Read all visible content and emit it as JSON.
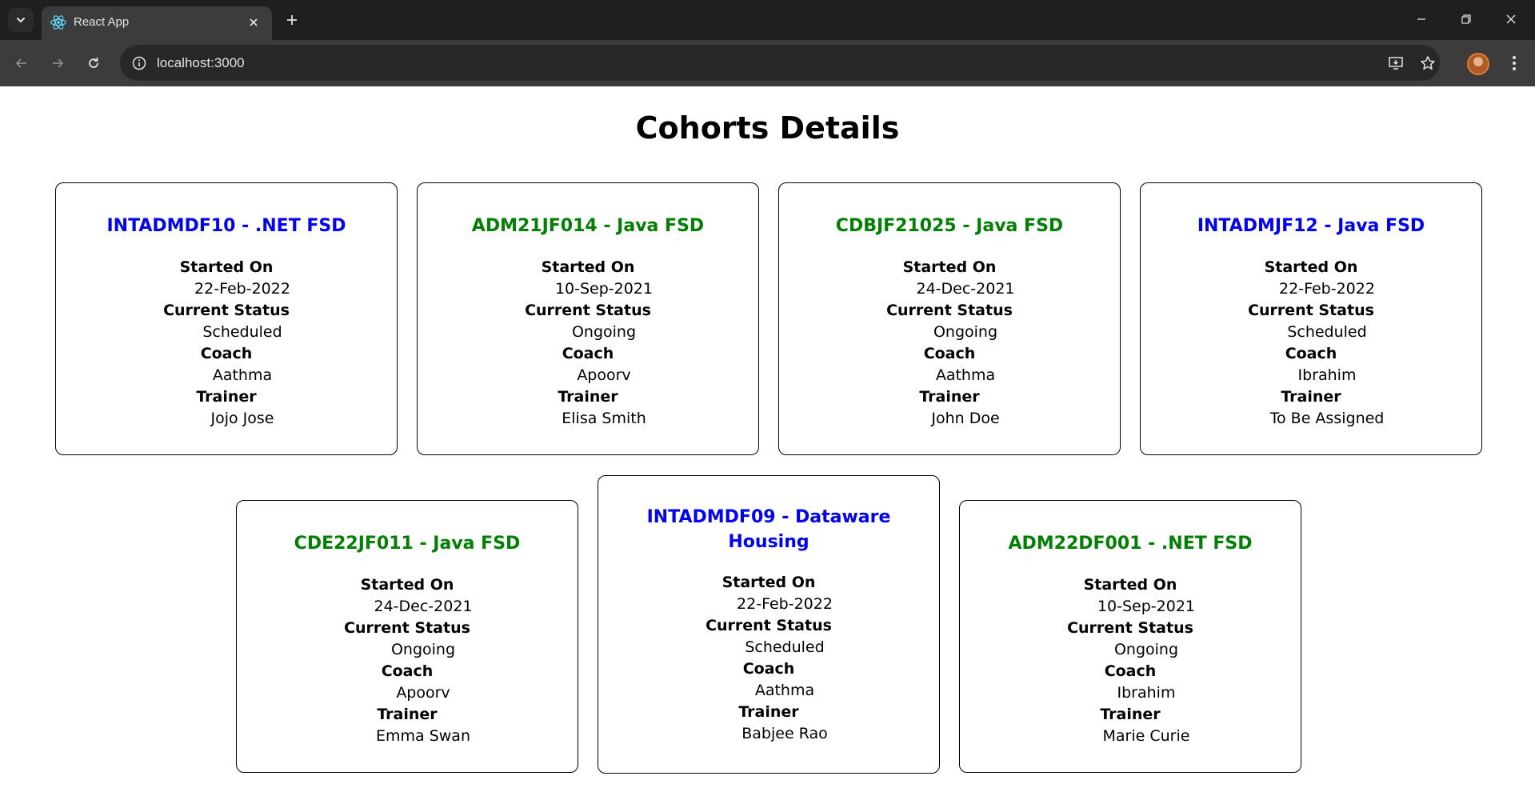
{
  "browser": {
    "tab_title": "React App",
    "url": "localhost:3000"
  },
  "page": {
    "title": "Cohorts Details"
  },
  "labels": {
    "started_on": "Started On",
    "current_status": "Current Status",
    "coach": "Coach",
    "trainer": "Trainer"
  },
  "colors": {
    "scheduled": "#0000ff",
    "ongoing": "#008000"
  },
  "cohorts": [
    {
      "title": "INTADMDF10 - .NET FSD",
      "started_on": "22-Feb-2022",
      "status": "Scheduled",
      "coach": "Aathma",
      "trainer": "Jojo Jose"
    },
    {
      "title": "ADM21JF014 - Java FSD",
      "started_on": "10-Sep-2021",
      "status": "Ongoing",
      "coach": "Apoorv",
      "trainer": "Elisa Smith"
    },
    {
      "title": "CDBJF21025 - Java FSD",
      "started_on": "24-Dec-2021",
      "status": "Ongoing",
      "coach": "Aathma",
      "trainer": "John Doe"
    },
    {
      "title": "INTADMJF12 - Java FSD",
      "started_on": "22-Feb-2022",
      "status": "Scheduled",
      "coach": "Ibrahim",
      "trainer": "To Be Assigned"
    },
    {
      "title": "CDE22JF011 - Java FSD",
      "started_on": "24-Dec-2021",
      "status": "Ongoing",
      "coach": "Apoorv",
      "trainer": "Emma Swan"
    },
    {
      "title": "INTADMDF09 - Dataware Housing",
      "started_on": "22-Feb-2022",
      "status": "Scheduled",
      "coach": "Aathma",
      "trainer": "Babjee Rao"
    },
    {
      "title": "ADM22DF001 - .NET FSD",
      "started_on": "10-Sep-2021",
      "status": "Ongoing",
      "coach": "Ibrahim",
      "trainer": "Marie Curie"
    }
  ]
}
